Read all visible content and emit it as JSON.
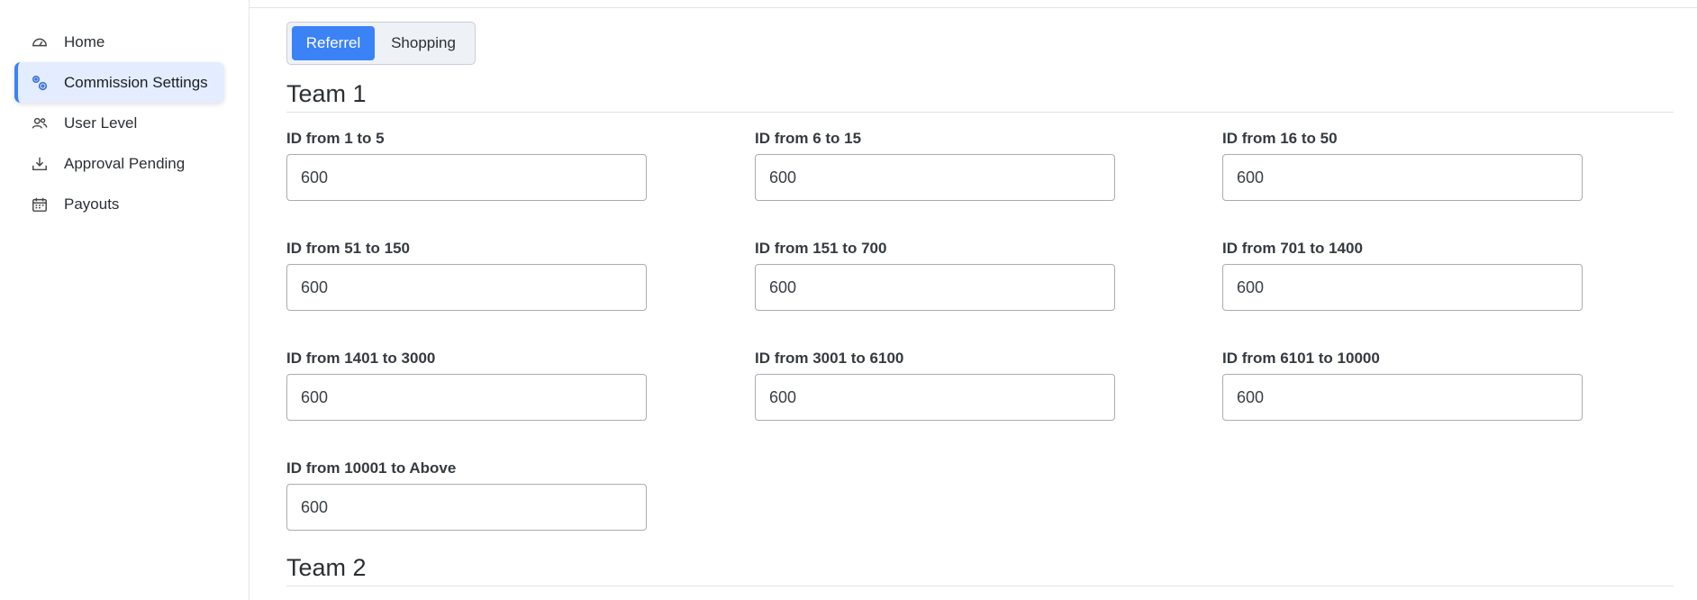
{
  "sidebar": {
    "items": [
      {
        "label": "Home",
        "icon": "dashboard-gauge-icon",
        "active": false
      },
      {
        "label": "Commission Settings",
        "icon": "gears-icon",
        "active": true
      },
      {
        "label": "User Level",
        "icon": "users-icon",
        "active": false
      },
      {
        "label": "Approval Pending",
        "icon": "download-tray-icon",
        "active": false
      },
      {
        "label": "Payouts",
        "icon": "calendar-icon",
        "active": false
      }
    ]
  },
  "tabs": {
    "referrel": "Referrel",
    "shopping": "Shopping",
    "active": "Referrel"
  },
  "accent_color": "#3b82f6",
  "teams": [
    {
      "title": "Team 1",
      "fields": [
        {
          "label": "ID from 1 to 5",
          "value": "600"
        },
        {
          "label": "ID from 6 to 15",
          "value": "600"
        },
        {
          "label": "ID from 16 to 50",
          "value": "600"
        },
        {
          "label": "ID from 51 to 150",
          "value": "600"
        },
        {
          "label": "ID from 151 to 700",
          "value": "600"
        },
        {
          "label": "ID from 701 to 1400",
          "value": "600"
        },
        {
          "label": "ID from 1401 to 3000",
          "value": "600"
        },
        {
          "label": "ID from 3001 to 6100",
          "value": "600"
        },
        {
          "label": "ID from 6101 to 10000",
          "value": "600"
        },
        {
          "label": "ID from 10001 to Above",
          "value": "600"
        }
      ]
    },
    {
      "title": "Team 2",
      "fields": []
    }
  ]
}
